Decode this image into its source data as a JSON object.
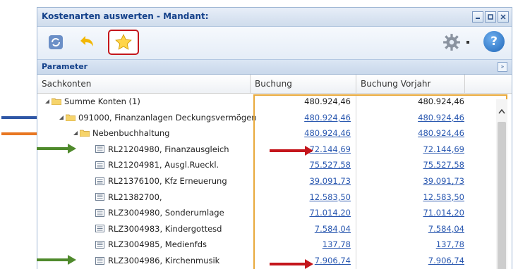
{
  "window": {
    "title": "Kostenarten auswerten - Mandant:"
  },
  "toolbar": {
    "refresh_icon": "refresh-icon",
    "undo_icon": "undo-icon",
    "favorite_icon": "star-icon",
    "settings_icon": "gear-icon",
    "help_icon": "help-icon",
    "help_label": "?"
  },
  "parameter": {
    "label": "Parameter"
  },
  "grid": {
    "columns": [
      "Sachkonten",
      "Buchung",
      "Buchung Vorjahr"
    ],
    "rows": [
      {
        "label": "Summe Konten (1)",
        "buchung": "480.924,46",
        "vorjahr": "480.924,46"
      },
      {
        "label": "091000, Finanzanlagen Deckungsvermögen",
        "buchung": "480.924,46",
        "vorjahr": "480.924,46"
      },
      {
        "label": "Nebenbuchhaltung",
        "buchung": "480.924,46",
        "vorjahr": "480.924,46"
      },
      {
        "label": "RL21204980, Finanzausgleich",
        "buchung": "72.144,69",
        "vorjahr": "72.144,69"
      },
      {
        "label": "RL21204981, Ausgl.Rueckl.",
        "buchung": "75.527,58",
        "vorjahr": "75.527,58"
      },
      {
        "label": "RL21376100, Kfz Erneuerung",
        "buchung": "39.091,73",
        "vorjahr": "39.091,73"
      },
      {
        "label": "RL21382700, ",
        "buchung": "12.583,50",
        "vorjahr": "12.583,50"
      },
      {
        "label": "RLZ3004980, Sonderumlage",
        "buchung": "71.014,20",
        "vorjahr": "71.014,20"
      },
      {
        "label": "RLZ3004983, Kindergottesd",
        "buchung": "7.584,04",
        "vorjahr": "7.584,04"
      },
      {
        "label": "RLZ3004985, Medienfds",
        "buchung": "137,78",
        "vorjahr": "137,78"
      },
      {
        "label": "RLZ3004986, Kirchenmusik",
        "buchung": "7.906,74",
        "vorjahr": "7.906,74"
      }
    ]
  },
  "colors": {
    "arrow_blue": "#2f57a6",
    "arrow_orange": "#e87722",
    "arrow_green": "#4f8a2c",
    "arrow_red": "#c4161c",
    "highlight_box": "#e8a93c"
  }
}
